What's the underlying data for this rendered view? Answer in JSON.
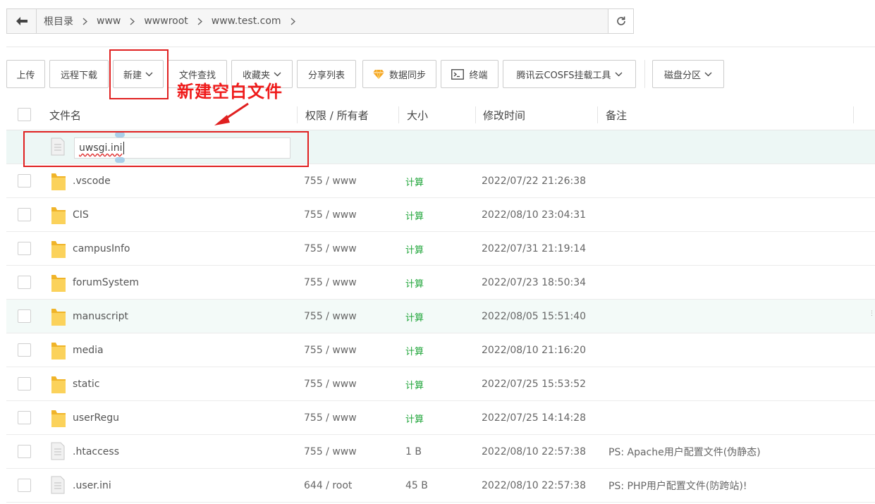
{
  "breadcrumb": {
    "back_icon": "arrow-left-icon",
    "items": [
      "根目录",
      "www",
      "wwwroot",
      "www.test.com"
    ],
    "refresh_icon": "refresh-icon"
  },
  "toolbar": {
    "upload": "上传",
    "remote_download": "远程下载",
    "new": "新建",
    "file_search": "文件查找",
    "favorites": "收藏夹",
    "share_list": "分享列表",
    "data_sync": "数据同步",
    "data_sync_icon": "diamond-icon",
    "terminal": "终端",
    "terminal_icon": "terminal-icon",
    "cosfs": "腾讯云COSFS挂载工具",
    "disk_partition": "磁盘分区"
  },
  "annotation": {
    "text": "新建空白文件",
    "color": "#ef1b1b"
  },
  "table": {
    "headers": {
      "name": "文件名",
      "perm": "权限 / 所有者",
      "size": "大小",
      "mtime": "修改时间",
      "note": "备注"
    },
    "new_file_input": "uwsgi.ini",
    "rows": [
      {
        "name": ".vscode",
        "type": "folder",
        "perm": "755 / www",
        "size": "计算",
        "mtime": "2022/07/22 21:26:38",
        "note": ""
      },
      {
        "name": "CIS",
        "type": "folder",
        "perm": "755 / www",
        "size": "计算",
        "mtime": "2022/08/10 23:04:31",
        "note": ""
      },
      {
        "name": "campusInfo",
        "type": "folder",
        "perm": "755 / www",
        "size": "计算",
        "mtime": "2022/07/31 21:19:14",
        "note": ""
      },
      {
        "name": "forumSystem",
        "type": "folder",
        "perm": "755 / www",
        "size": "计算",
        "mtime": "2022/07/23 18:50:34",
        "note": ""
      },
      {
        "name": "manuscript",
        "type": "folder",
        "perm": "755 / www",
        "size": "计算",
        "mtime": "2022/08/05 15:51:40",
        "note": ""
      },
      {
        "name": "media",
        "type": "folder",
        "perm": "755 / www",
        "size": "计算",
        "mtime": "2022/08/10 21:16:20",
        "note": ""
      },
      {
        "name": "static",
        "type": "folder",
        "perm": "755 / www",
        "size": "计算",
        "mtime": "2022/07/25 15:53:52",
        "note": ""
      },
      {
        "name": "userRegu",
        "type": "folder",
        "perm": "755 / www",
        "size": "计算",
        "mtime": "2022/07/25 14:14:28",
        "note": ""
      },
      {
        "name": ".htaccess",
        "type": "file",
        "perm": "755 / www",
        "size": "1 B",
        "mtime": "2022/08/10 22:57:38",
        "note": "PS: Apache用户配置文件(伪静态)"
      },
      {
        "name": ".user.ini",
        "type": "file",
        "perm": "644 / root",
        "size": "45 B",
        "mtime": "2022/08/10 22:57:38",
        "note": "PS: PHP用户配置文件(防跨站)!"
      }
    ]
  },
  "colors": {
    "calc_green": "#20a53a",
    "folder_yellow": "#f5c33b",
    "hover_row": "#f3faf8"
  }
}
